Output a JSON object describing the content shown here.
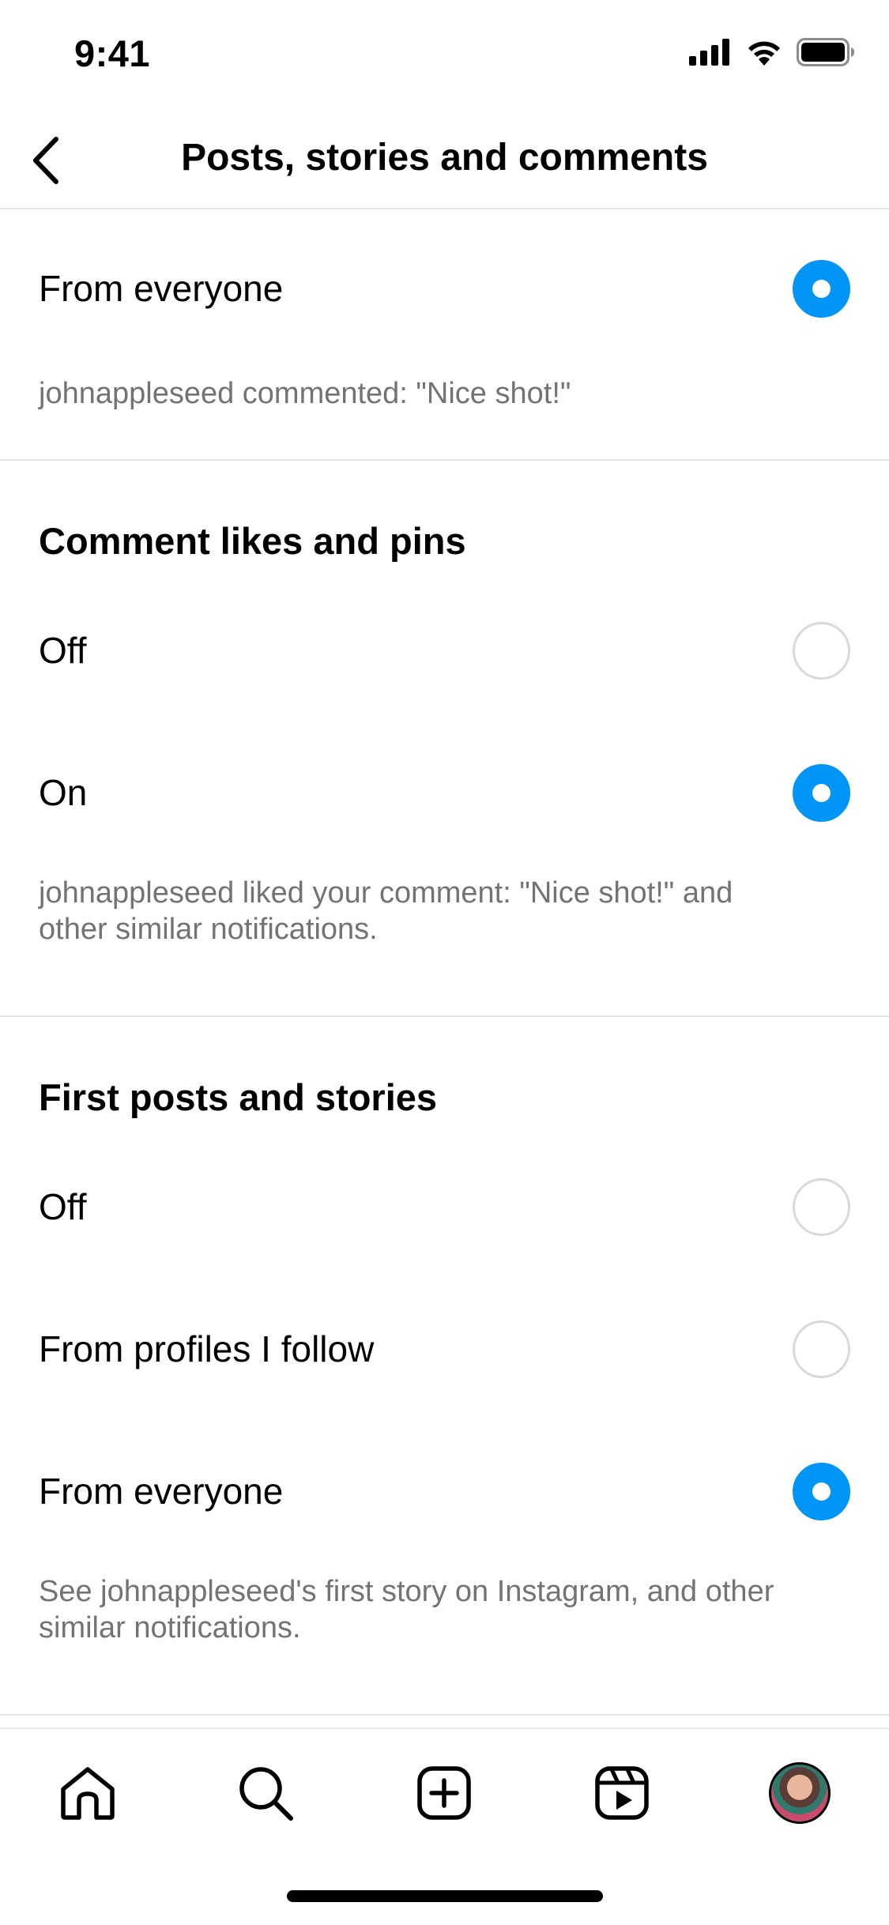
{
  "status_bar": {
    "time": "9:41"
  },
  "header": {
    "title": "Posts, stories and comments"
  },
  "comments": {
    "option_label": "From everyone",
    "description": "johnappleseed commented: \"Nice shot!\""
  },
  "comment_likes": {
    "title": "Comment likes and pins",
    "off_label": "Off",
    "on_label": "On",
    "description_line1": "johnappleseed liked your comment: \"Nice shot!\" and",
    "description_line2": "other similar notifications."
  },
  "first_posts": {
    "title": "First posts and stories",
    "off_label": "Off",
    "following_label": "From profiles I follow",
    "everyone_label": "From everyone",
    "description_line1": "See johnappleseed's first story on Instagram, and other",
    "description_line2": "similar notifications."
  },
  "tab_bar": {
    "items": [
      "home-icon",
      "search-icon",
      "create-icon",
      "reels-icon",
      "profile-avatar"
    ]
  },
  "colors": {
    "accent": "#0095f6",
    "secondary_text": "#737373",
    "divider": "#e4e4e4"
  }
}
